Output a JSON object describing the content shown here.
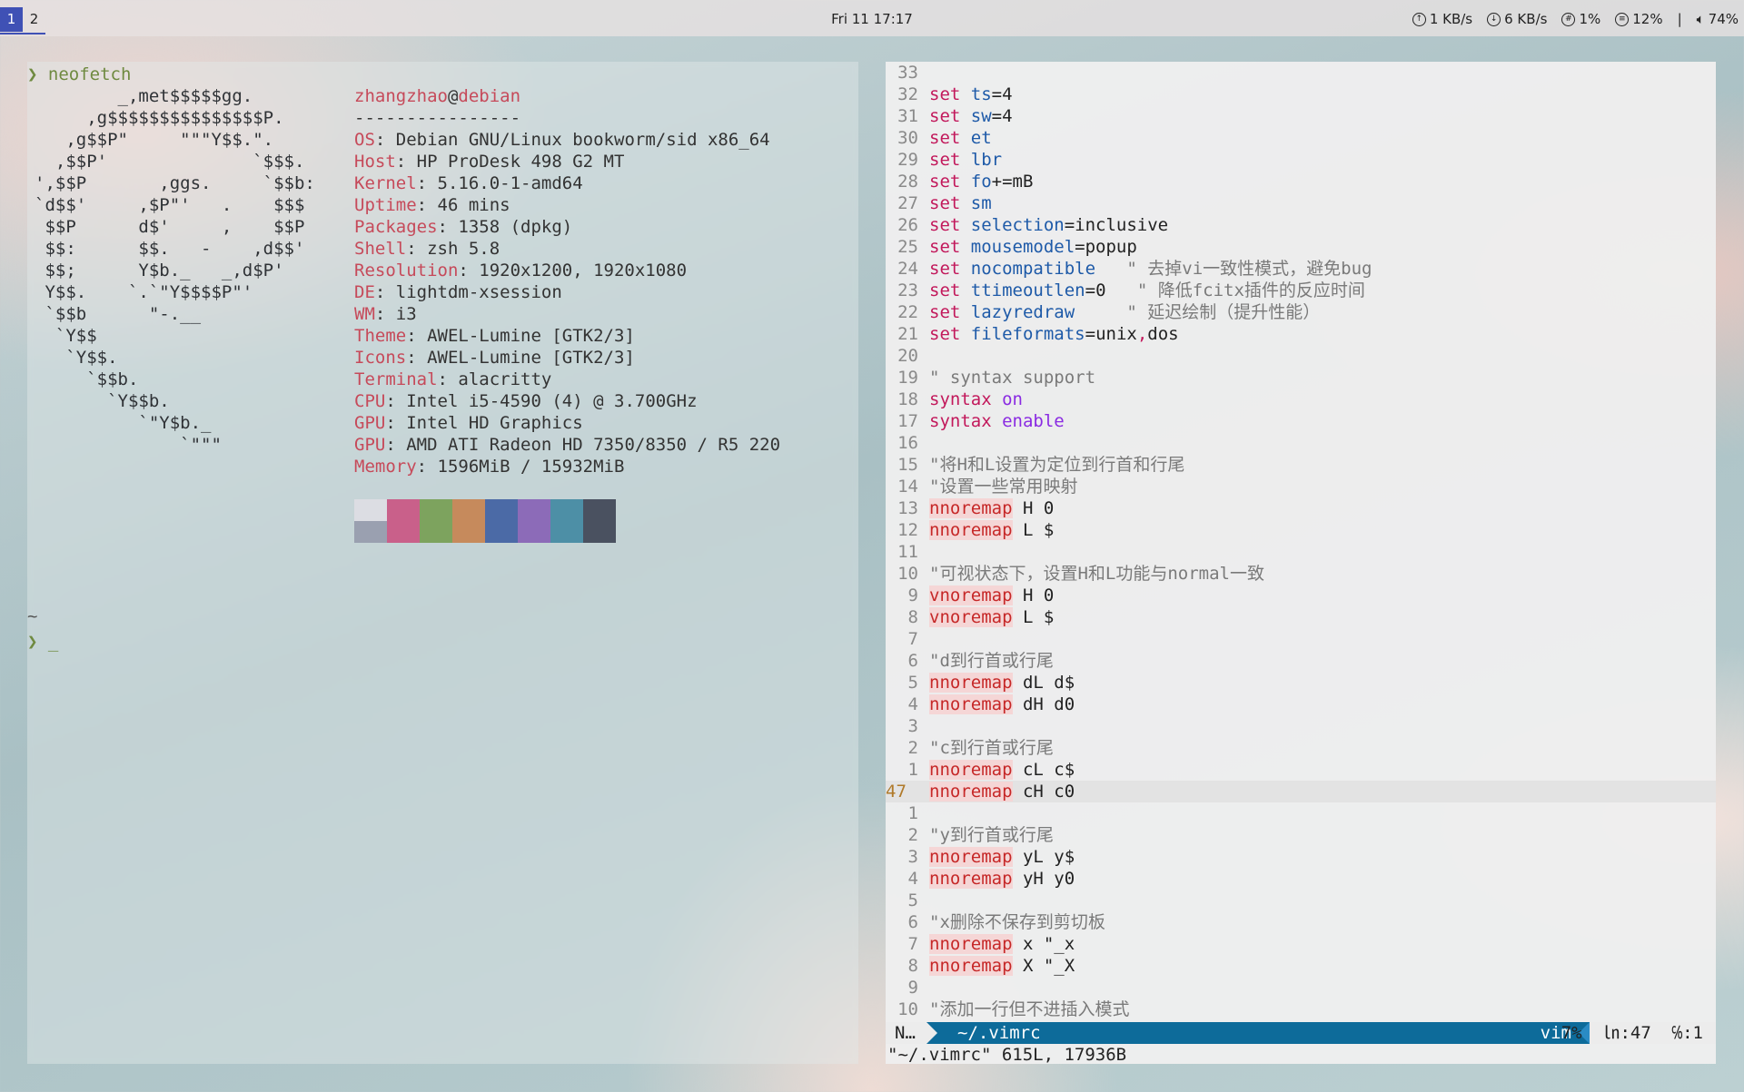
{
  "topbar": {
    "workspaces": [
      "1",
      "2"
    ],
    "active_workspace": "1",
    "clock": "Fri 11   17:17",
    "upload": "1 KB/s",
    "download": "6 KB/s",
    "cpu": "1%",
    "mem": "12%",
    "separator": "|",
    "volume": "74%",
    "accent_color": "#3f51b5"
  },
  "left_terminal": {
    "prompt_symbol": "❯",
    "command": "neofetch",
    "logo_lines": [
      "        _,met$$$$$gg.",
      "     ,g$$$$$$$$$$$$$$$P.",
      "   ,g$$P\"     \"\"\"Y$$.\".",
      "  ,$$P'              `$$$.",
      "',$$P       ,ggs.     `$$b:",
      "`d$$'     ,$P\"'   .    $$$",
      " $$P      d$'     ,    $$P",
      " $$:      $$.   -    ,d$$'",
      " $$;      Y$b._   _,d$P'",
      " Y$$.    `.`\"Y$$$$P\"'",
      " `$$b      \"-.__",
      "  `Y$$",
      "   `Y$$.",
      "     `$$b.",
      "       `Y$$b.",
      "          `\"Y$b._",
      "              `\"\"\""
    ],
    "user": "zhangzhao",
    "at": "@",
    "host": "debian",
    "separator": "----------------",
    "info": [
      {
        "key": "OS",
        "value": " Debian GNU/Linux bookworm/sid x86_64"
      },
      {
        "key": "Host",
        "value": " HP ProDesk 498 G2 MT"
      },
      {
        "key": "Kernel",
        "value": " 5.16.0-1-amd64"
      },
      {
        "key": "Uptime",
        "value": " 46 mins"
      },
      {
        "key": "Packages",
        "value": " 1358 (dpkg)"
      },
      {
        "key": "Shell",
        "value": " zsh 5.8"
      },
      {
        "key": "Resolution",
        "value": " 1920x1200, 1920x1080"
      },
      {
        "key": "DE",
        "value": " lightdm-xsession"
      },
      {
        "key": "WM",
        "value": " i3"
      },
      {
        "key": "Theme",
        "value": " AWEL-Lumine [GTK2/3]"
      },
      {
        "key": "Icons",
        "value": " AWEL-Lumine [GTK2/3]"
      },
      {
        "key": "Terminal",
        "value": " alacritty"
      },
      {
        "key": "CPU",
        "value": " Intel i5-4590 (4) @ 3.700GHz"
      },
      {
        "key": "GPU",
        "value": " Intel HD Graphics"
      },
      {
        "key": "GPU",
        "value": " AMD ATI Radeon HD 7350/8350 / R5 220"
      },
      {
        "key": "Memory",
        "value": " 1596MiB / 15932MiB"
      }
    ],
    "palette_top": [
      "#dcdde3",
      "#c9608a",
      "#7da35e",
      "#c68a5c",
      "#4b6aa6",
      "#8c6bb8",
      "#4d8fa6",
      "#4a5160"
    ],
    "palette_bottom": [
      "#9aa0b0",
      "#c9608a",
      "#7da35e",
      "#c68a5c",
      "#4b6aa6",
      "#8c6bb8",
      "#4d8fa6",
      "#4a5160"
    ],
    "tilde": "~",
    "cursor": "_"
  },
  "vim": {
    "lines": [
      {
        "n": "33",
        "parts": []
      },
      {
        "n": "32",
        "parts": [
          [
            "kw",
            "set"
          ],
          [
            "pl",
            " "
          ],
          [
            "opt",
            "ts"
          ],
          [
            "val",
            "=4"
          ]
        ]
      },
      {
        "n": "31",
        "parts": [
          [
            "kw",
            "set"
          ],
          [
            "pl",
            " "
          ],
          [
            "opt",
            "sw"
          ],
          [
            "val",
            "=4"
          ]
        ]
      },
      {
        "n": "30",
        "parts": [
          [
            "kw",
            "set"
          ],
          [
            "pl",
            " "
          ],
          [
            "opt",
            "et"
          ]
        ]
      },
      {
        "n": "29",
        "parts": [
          [
            "kw",
            "set"
          ],
          [
            "pl",
            " "
          ],
          [
            "opt",
            "lbr"
          ]
        ]
      },
      {
        "n": "28",
        "parts": [
          [
            "kw",
            "set"
          ],
          [
            "pl",
            " "
          ],
          [
            "opt",
            "fo"
          ],
          [
            "val",
            "+=mB"
          ]
        ]
      },
      {
        "n": "27",
        "parts": [
          [
            "kw",
            "set"
          ],
          [
            "pl",
            " "
          ],
          [
            "opt",
            "sm"
          ]
        ]
      },
      {
        "n": "26",
        "parts": [
          [
            "kw",
            "set"
          ],
          [
            "pl",
            " "
          ],
          [
            "opt",
            "selection"
          ],
          [
            "val",
            "=inclusive"
          ]
        ]
      },
      {
        "n": "25",
        "parts": [
          [
            "kw",
            "set"
          ],
          [
            "pl",
            " "
          ],
          [
            "opt",
            "mousemodel"
          ],
          [
            "val",
            "=popup"
          ]
        ]
      },
      {
        "n": "24",
        "parts": [
          [
            "kw",
            "set"
          ],
          [
            "pl",
            " "
          ],
          [
            "opt",
            "nocompatible"
          ],
          [
            "cmt",
            "   \" 去掉vi一致性模式，避免bug"
          ]
        ]
      },
      {
        "n": "23",
        "parts": [
          [
            "kw",
            "set"
          ],
          [
            "pl",
            " "
          ],
          [
            "opt",
            "ttimeoutlen"
          ],
          [
            "val",
            "=0"
          ],
          [
            "cmt",
            "   \" 降低fcitx插件的反应时间"
          ]
        ]
      },
      {
        "n": "22",
        "parts": [
          [
            "kw",
            "set"
          ],
          [
            "pl",
            " "
          ],
          [
            "opt",
            "lazyredraw"
          ],
          [
            "cmt",
            "     \" 延迟绘制（提升性能）"
          ]
        ]
      },
      {
        "n": "21",
        "parts": [
          [
            "kw",
            "set"
          ],
          [
            "pl",
            " "
          ],
          [
            "opt",
            "fileformats"
          ],
          [
            "val",
            "=unix"
          ],
          [
            "kw",
            ","
          ],
          [
            "val",
            "dos"
          ]
        ]
      },
      {
        "n": "20",
        "parts": []
      },
      {
        "n": "19",
        "parts": [
          [
            "cmt",
            "\" syntax support"
          ]
        ]
      },
      {
        "n": "18",
        "parts": [
          [
            "kw",
            "syntax"
          ],
          [
            "pl",
            " "
          ],
          [
            "synkw",
            "on"
          ]
        ]
      },
      {
        "n": "17",
        "parts": [
          [
            "kw",
            "syntax"
          ],
          [
            "pl",
            " "
          ],
          [
            "synkw",
            "enable"
          ]
        ]
      },
      {
        "n": "16",
        "parts": []
      },
      {
        "n": "15",
        "parts": [
          [
            "cmt",
            "\"将H和L设置为定位到行首和行尾"
          ]
        ]
      },
      {
        "n": "14",
        "parts": [
          [
            "cmt",
            "\"设置一些常用映射"
          ]
        ]
      },
      {
        "n": "13",
        "parts": [
          [
            "map",
            "nnoremap"
          ],
          [
            "pl",
            " H 0"
          ]
        ]
      },
      {
        "n": "12",
        "parts": [
          [
            "map",
            "nnoremap"
          ],
          [
            "pl",
            " L $"
          ]
        ]
      },
      {
        "n": "11",
        "parts": []
      },
      {
        "n": "10",
        "parts": [
          [
            "cmt",
            "\"可视状态下，设置H和L功能与normal一致"
          ]
        ]
      },
      {
        "n": "9",
        "parts": [
          [
            "map",
            "vnoremap"
          ],
          [
            "pl",
            " H 0"
          ]
        ]
      },
      {
        "n": "8",
        "parts": [
          [
            "map",
            "vnoremap"
          ],
          [
            "pl",
            " L $"
          ]
        ]
      },
      {
        "n": "7",
        "parts": []
      },
      {
        "n": "6",
        "parts": [
          [
            "cmt",
            "\"d到行首或行尾"
          ]
        ]
      },
      {
        "n": "5",
        "parts": [
          [
            "map",
            "nnoremap"
          ],
          [
            "pl",
            " dL d$"
          ]
        ]
      },
      {
        "n": "4",
        "parts": [
          [
            "map",
            "nnoremap"
          ],
          [
            "pl",
            " dH d0"
          ]
        ]
      },
      {
        "n": "3",
        "parts": []
      },
      {
        "n": "2",
        "parts": [
          [
            "cmt",
            "\"c到行首或行尾"
          ]
        ]
      },
      {
        "n": "1",
        "parts": [
          [
            "map",
            "nnoremap"
          ],
          [
            "pl",
            " cL c$"
          ]
        ]
      },
      {
        "n": "47",
        "current": true,
        "parts": [
          [
            "map",
            "nnoremap"
          ],
          [
            "pl",
            " cH c0"
          ]
        ]
      },
      {
        "n": "1",
        "parts": []
      },
      {
        "n": "2",
        "parts": [
          [
            "cmt",
            "\"y到行首或行尾"
          ]
        ]
      },
      {
        "n": "3",
        "parts": [
          [
            "map",
            "nnoremap"
          ],
          [
            "pl",
            " yL y$"
          ]
        ]
      },
      {
        "n": "4",
        "parts": [
          [
            "map",
            "nnoremap"
          ],
          [
            "pl",
            " yH y0"
          ]
        ]
      },
      {
        "n": "5",
        "parts": []
      },
      {
        "n": "6",
        "parts": [
          [
            "cmt",
            "\"x删除不保存到剪切板"
          ]
        ]
      },
      {
        "n": "7",
        "parts": [
          [
            "map",
            "nnoremap"
          ],
          [
            "pl",
            " x \"_x"
          ]
        ]
      },
      {
        "n": "8",
        "parts": [
          [
            "map",
            "nnoremap"
          ],
          [
            "pl",
            " X \"_X"
          ]
        ]
      },
      {
        "n": "9",
        "parts": []
      },
      {
        "n": "10",
        "parts": [
          [
            "cmt",
            "\"添加一行但不进插入模式"
          ]
        ]
      }
    ],
    "status": {
      "mode": "N…",
      "file": "~/.vimrc",
      "filetype": "vim",
      "position": "7%  ㏑:47  ℅:1"
    },
    "message": "\"~/.vimrc\" 615L, 17936B",
    "accent_color": "#0d6b9a"
  }
}
